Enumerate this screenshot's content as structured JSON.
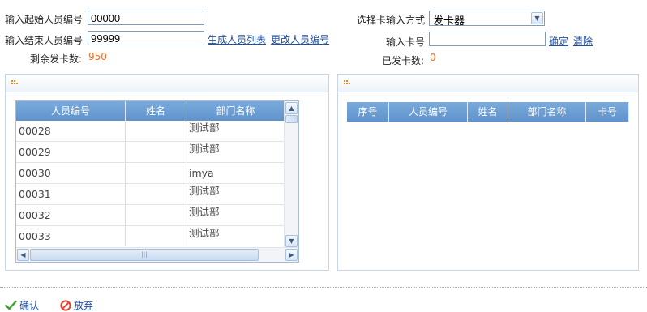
{
  "form": {
    "start_label": "输入起始人员编号",
    "start_value": "00000",
    "end_label": "输入结束人员编号",
    "end_value": "99999",
    "generate_link": "生成人员列表",
    "change_link": "更改人员编号",
    "remaining_label": "剩余发卡数:",
    "remaining_value": "950",
    "card_method_label": "选择卡输入方式",
    "card_method_value": "发卡器",
    "card_no_label": "输入卡号",
    "card_no_value": "",
    "confirm_link": "确定",
    "clear_link": "清除",
    "issued_label": "已发卡数:",
    "issued_value": "0"
  },
  "left_grid": {
    "columns": [
      "人员编号",
      "姓名",
      "部门名称"
    ],
    "rows": [
      {
        "id": "00028",
        "name": "",
        "dept": "测试部"
      },
      {
        "id": "00029",
        "name": "",
        "dept": "测试部"
      },
      {
        "id": "00030",
        "name": "",
        "dept": "imya"
      },
      {
        "id": "00031",
        "name": "",
        "dept": "测试部"
      },
      {
        "id": "00032",
        "name": "",
        "dept": "测试部"
      },
      {
        "id": "00033",
        "name": "",
        "dept": "测试部"
      }
    ]
  },
  "right_grid": {
    "columns": [
      "序号",
      "人员编号",
      "姓名",
      "部门名称",
      "卡号"
    ]
  },
  "footer": {
    "confirm_label": "确认",
    "cancel_label": "放弃"
  },
  "colors": {
    "accent": "#1f4fa0",
    "count": "#f07020",
    "grid_header": "#6a9cd3"
  }
}
